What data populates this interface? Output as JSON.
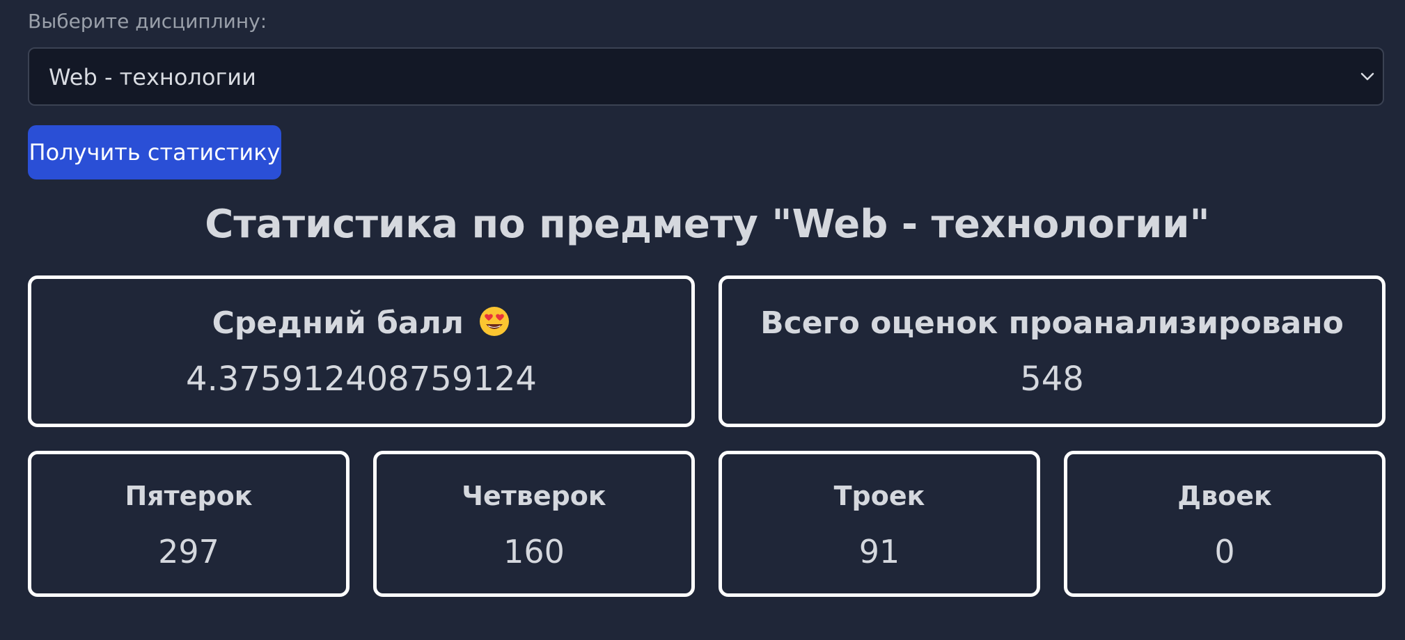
{
  "form": {
    "label": "Выберите дисциплину:",
    "selected": "Web - технологии",
    "submit_label": "Получить статистику"
  },
  "stats": {
    "heading": "Статистика по предмету \"Web - технологии\"",
    "average": {
      "title": "Средний балл",
      "icon": "heart-eyes-emoji",
      "value": "4.375912408759124"
    },
    "total": {
      "title": "Всего оценок проанализировано",
      "value": "548"
    },
    "grades": [
      {
        "title": "Пятерок",
        "value": "297"
      },
      {
        "title": "Четверок",
        "value": "160"
      },
      {
        "title": "Троек",
        "value": "91"
      },
      {
        "title": "Двоек",
        "value": "0"
      }
    ]
  },
  "colors": {
    "background": "#1f2638",
    "select_background": "#131826",
    "button": "#2a4fd6",
    "card_border": "#ffffff"
  }
}
